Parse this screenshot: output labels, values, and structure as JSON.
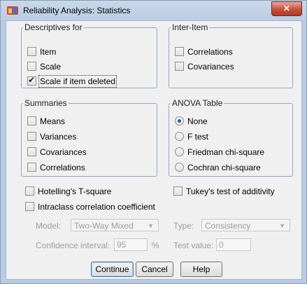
{
  "window": {
    "title": "Reliability Analysis: Statistics",
    "close_glyph": "✕"
  },
  "descriptives": {
    "legend": "Descriptives for",
    "items": [
      {
        "label": "Item",
        "checked": false
      },
      {
        "label": "Scale",
        "checked": false
      },
      {
        "label": "Scale if item deleted",
        "checked": true
      }
    ]
  },
  "inter_item": {
    "legend": "Inter-Item",
    "items": [
      {
        "label": "Correlations",
        "checked": false
      },
      {
        "label": "Covariances",
        "checked": false
      }
    ]
  },
  "summaries": {
    "legend": "Summaries",
    "items": [
      {
        "label": "Means",
        "checked": false
      },
      {
        "label": "Variances",
        "checked": false
      },
      {
        "label": "Covariances",
        "checked": false
      },
      {
        "label": "Correlations",
        "checked": false
      }
    ]
  },
  "anova": {
    "legend": "ANOVA Table",
    "items": [
      {
        "label": "None",
        "selected": true
      },
      {
        "label": "F test",
        "selected": false
      },
      {
        "label": "Friedman chi-square",
        "selected": false
      },
      {
        "label": "Cochran chi-square",
        "selected": false
      }
    ]
  },
  "extra": {
    "hotelling": "Hotelling's T-square",
    "tukey": "Tukey's test of additivity",
    "intraclass": "Intraclass correlation coefficient"
  },
  "icc": {
    "model_label": "Model:",
    "model_value": "Two-Way Mixed",
    "type_label": "Type:",
    "type_value": "Consistency",
    "ci_label": "Confidence interval:",
    "ci_value": "95",
    "ci_unit": "%",
    "test_value_label": "Test value:",
    "test_value": "0"
  },
  "buttons": {
    "continue": "Continue",
    "cancel": "Cancel",
    "help": "Help"
  },
  "colors": {
    "title_gradient": "#c9d8ea",
    "close_button": "#c7503a",
    "group_border": "#93a9c8",
    "radio_dot": "#2457c5"
  }
}
